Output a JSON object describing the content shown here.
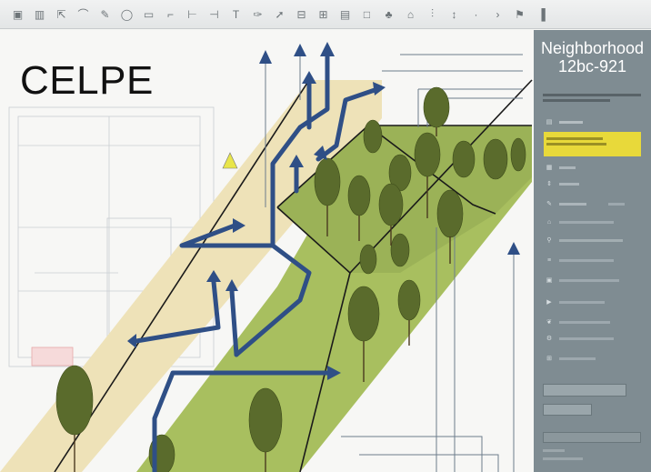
{
  "app": {
    "title": "CELPE"
  },
  "toolbar": {
    "items": [
      {
        "name": "select-tool-icon"
      },
      {
        "name": "layers-icon"
      },
      {
        "name": "move-icon"
      },
      {
        "name": "shape-icon"
      },
      {
        "name": "draw-icon"
      },
      {
        "name": "ellipse-icon"
      },
      {
        "name": "frame-icon"
      },
      {
        "name": "path-icon"
      },
      {
        "name": "measure-icon"
      },
      {
        "name": "guide-icon"
      },
      {
        "name": "text-icon"
      },
      {
        "name": "pen-icon"
      },
      {
        "name": "arrow-icon"
      },
      {
        "name": "align-icon"
      },
      {
        "name": "distribute-icon"
      },
      {
        "name": "stack-icon"
      },
      {
        "name": "square-icon"
      },
      {
        "name": "tree-icon"
      },
      {
        "name": "home-icon"
      },
      {
        "name": "split-icon"
      },
      {
        "name": "transform-icon"
      },
      {
        "name": "dot-icon"
      },
      {
        "name": "chevron-icon"
      },
      {
        "name": "flag-icon"
      },
      {
        "name": "panel-toggle-icon"
      }
    ]
  },
  "panel": {
    "title_line1": "Neighborhood",
    "title_line2": "12bc-921"
  },
  "colors": {
    "panel_bg": "#7f8c92",
    "accent_yellow": "#e8d93a",
    "arrow_blue": "#2f4f86",
    "grass_green": "#a6bd5e",
    "sand": "#eee2b8"
  }
}
